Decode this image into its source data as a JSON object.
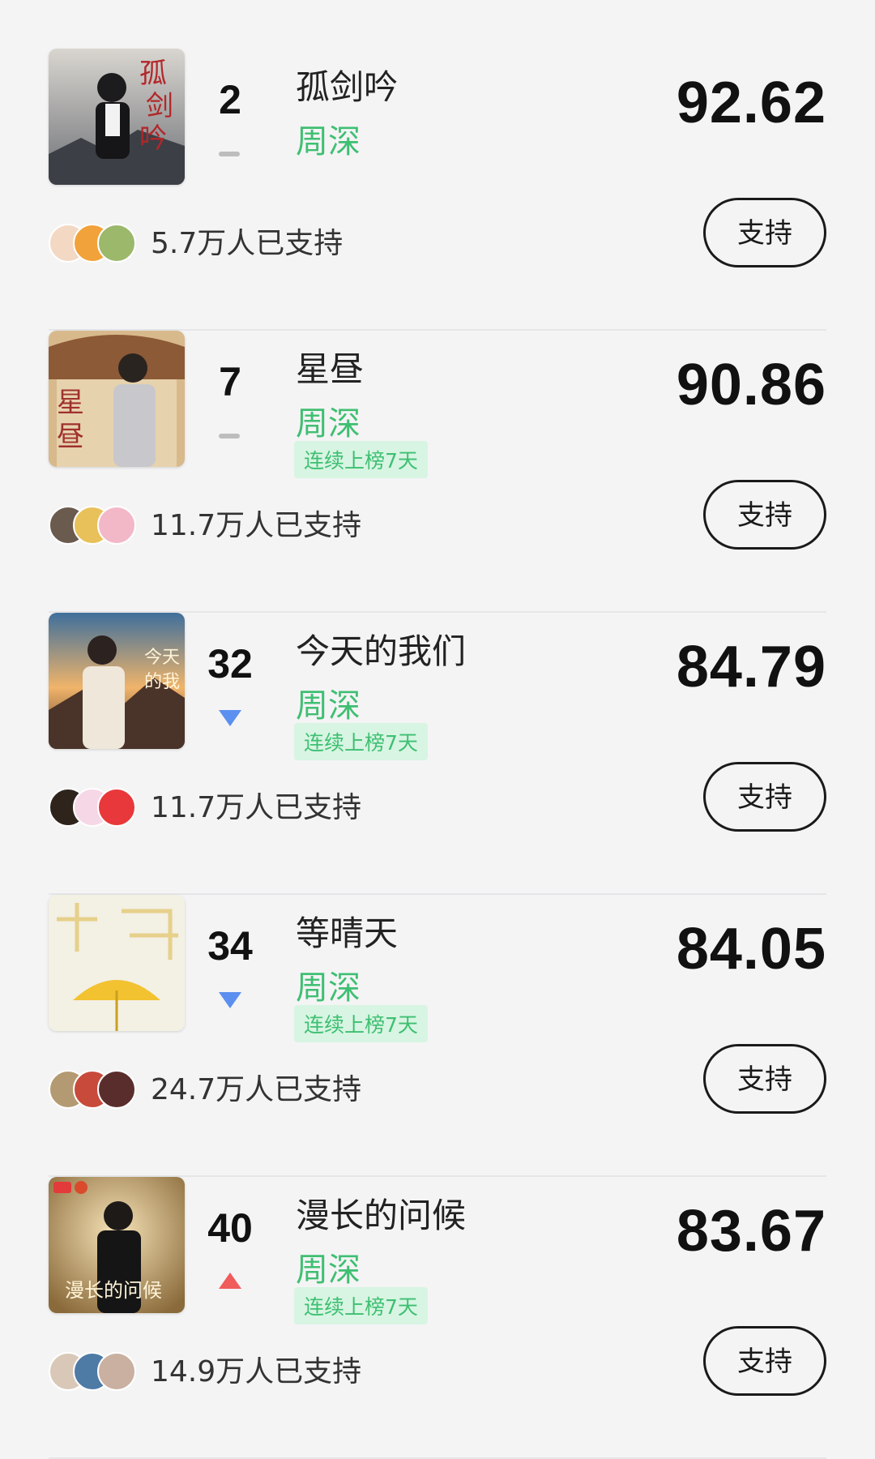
{
  "entries": [
    {
      "rank": "2",
      "trend": "flat",
      "title": "孤剑吟",
      "artist": "周深",
      "streak": "",
      "score": "92.62",
      "support_text": "5.7万人已支持",
      "button": "支持",
      "cover_theme": "dark-ink-painting",
      "avatar_colors": [
        "#f3d8c4",
        "#f2a23a",
        "#9bb86b"
      ]
    },
    {
      "rank": "7",
      "trend": "flat",
      "title": "星昼",
      "artist": "周深",
      "streak": "连续上榜7天",
      "score": "90.86",
      "support_text": "11.7万人已支持",
      "button": "支持",
      "cover_theme": "ancient-palace",
      "avatar_colors": [
        "#6b5a4e",
        "#e8c15a",
        "#f3b8c8"
      ]
    },
    {
      "rank": "32",
      "trend": "down",
      "title": "今天的我们",
      "artist": "周深",
      "streak": "连续上榜7天",
      "score": "84.79",
      "support_text": "11.7万人已支持",
      "button": "支持",
      "cover_theme": "sunset-mountains",
      "avatar_colors": [
        "#2e241c",
        "#f6d7e6",
        "#e8383b"
      ]
    },
    {
      "rank": "34",
      "trend": "down",
      "title": "等晴天",
      "artist": "周深",
      "streak": "连续上榜7天",
      "score": "84.05",
      "support_text": "24.7万人已支持",
      "button": "支持",
      "cover_theme": "yellow-umbrella",
      "avatar_colors": [
        "#b49a72",
        "#c84a3a",
        "#5a2d2d"
      ]
    },
    {
      "rank": "40",
      "trend": "up",
      "title": "漫长的问候",
      "artist": "周深",
      "streak": "连续上榜7天",
      "score": "83.67",
      "support_text": "14.9万人已支持",
      "button": "支持",
      "cover_theme": "warm-gold-portrait",
      "avatar_colors": [
        "#d9c8b8",
        "#4e7aa6",
        "#c9b0a0"
      ]
    }
  ]
}
